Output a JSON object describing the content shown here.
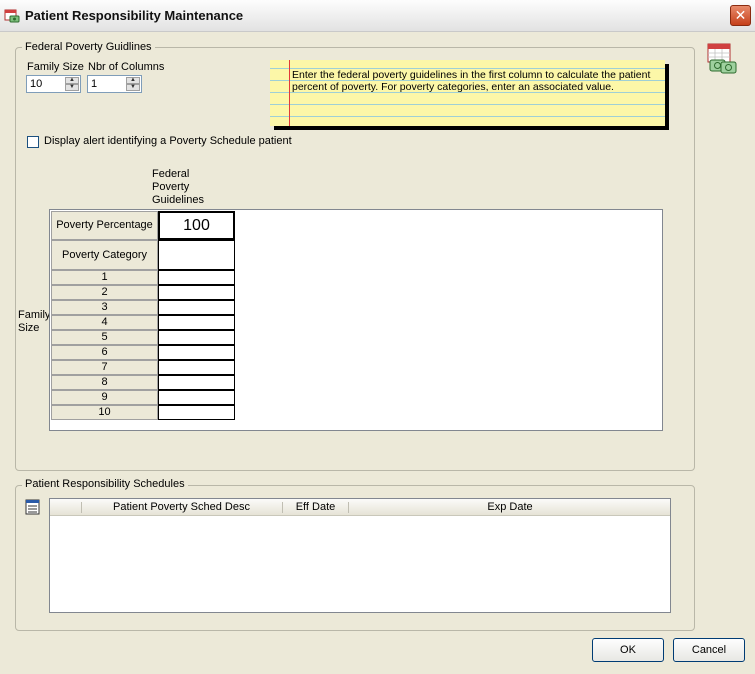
{
  "window": {
    "title": "Patient Responsibility Maintenance",
    "close_glyph": "✕"
  },
  "poverty_guidelines": {
    "group_label": "Federal Poverty Guidlines",
    "family_size_label": "Family Size",
    "family_size_value": "10",
    "nbr_columns_label": "Nbr of Columns",
    "nbr_columns_value": "1",
    "note_text": "Enter the federal poverty guidelines in the first column to calculate the patient percent of poverty.  For poverty categories, enter an associated value.",
    "alert_checkbox_label": "Display alert identifying a Poverty Schedule patient",
    "alert_checked": false,
    "column_header": "Federal Poverty Guidelines",
    "column_header_lines": [
      "Federal",
      "Poverty",
      "Guidelines"
    ],
    "row_poverty_percentage": "Poverty Percentage",
    "poverty_percentage_value": "100",
    "row_poverty_category": "Poverty Category",
    "family_size_side_label": [
      "Family",
      "Size"
    ],
    "family_rows": [
      "1",
      "2",
      "3",
      "4",
      "5",
      "6",
      "7",
      "8",
      "9",
      "10"
    ]
  },
  "schedules": {
    "group_label": "Patient Responsibility Schedules",
    "columns": [
      "Patient Poverty Sched Desc",
      "Eff Date",
      "Exp Date"
    ]
  },
  "buttons": {
    "ok": "OK",
    "cancel": "Cancel"
  },
  "icons": {
    "title": "calendar-money-icon",
    "corner": "calendar-money-icon",
    "list_tool": "list-properties-icon"
  }
}
